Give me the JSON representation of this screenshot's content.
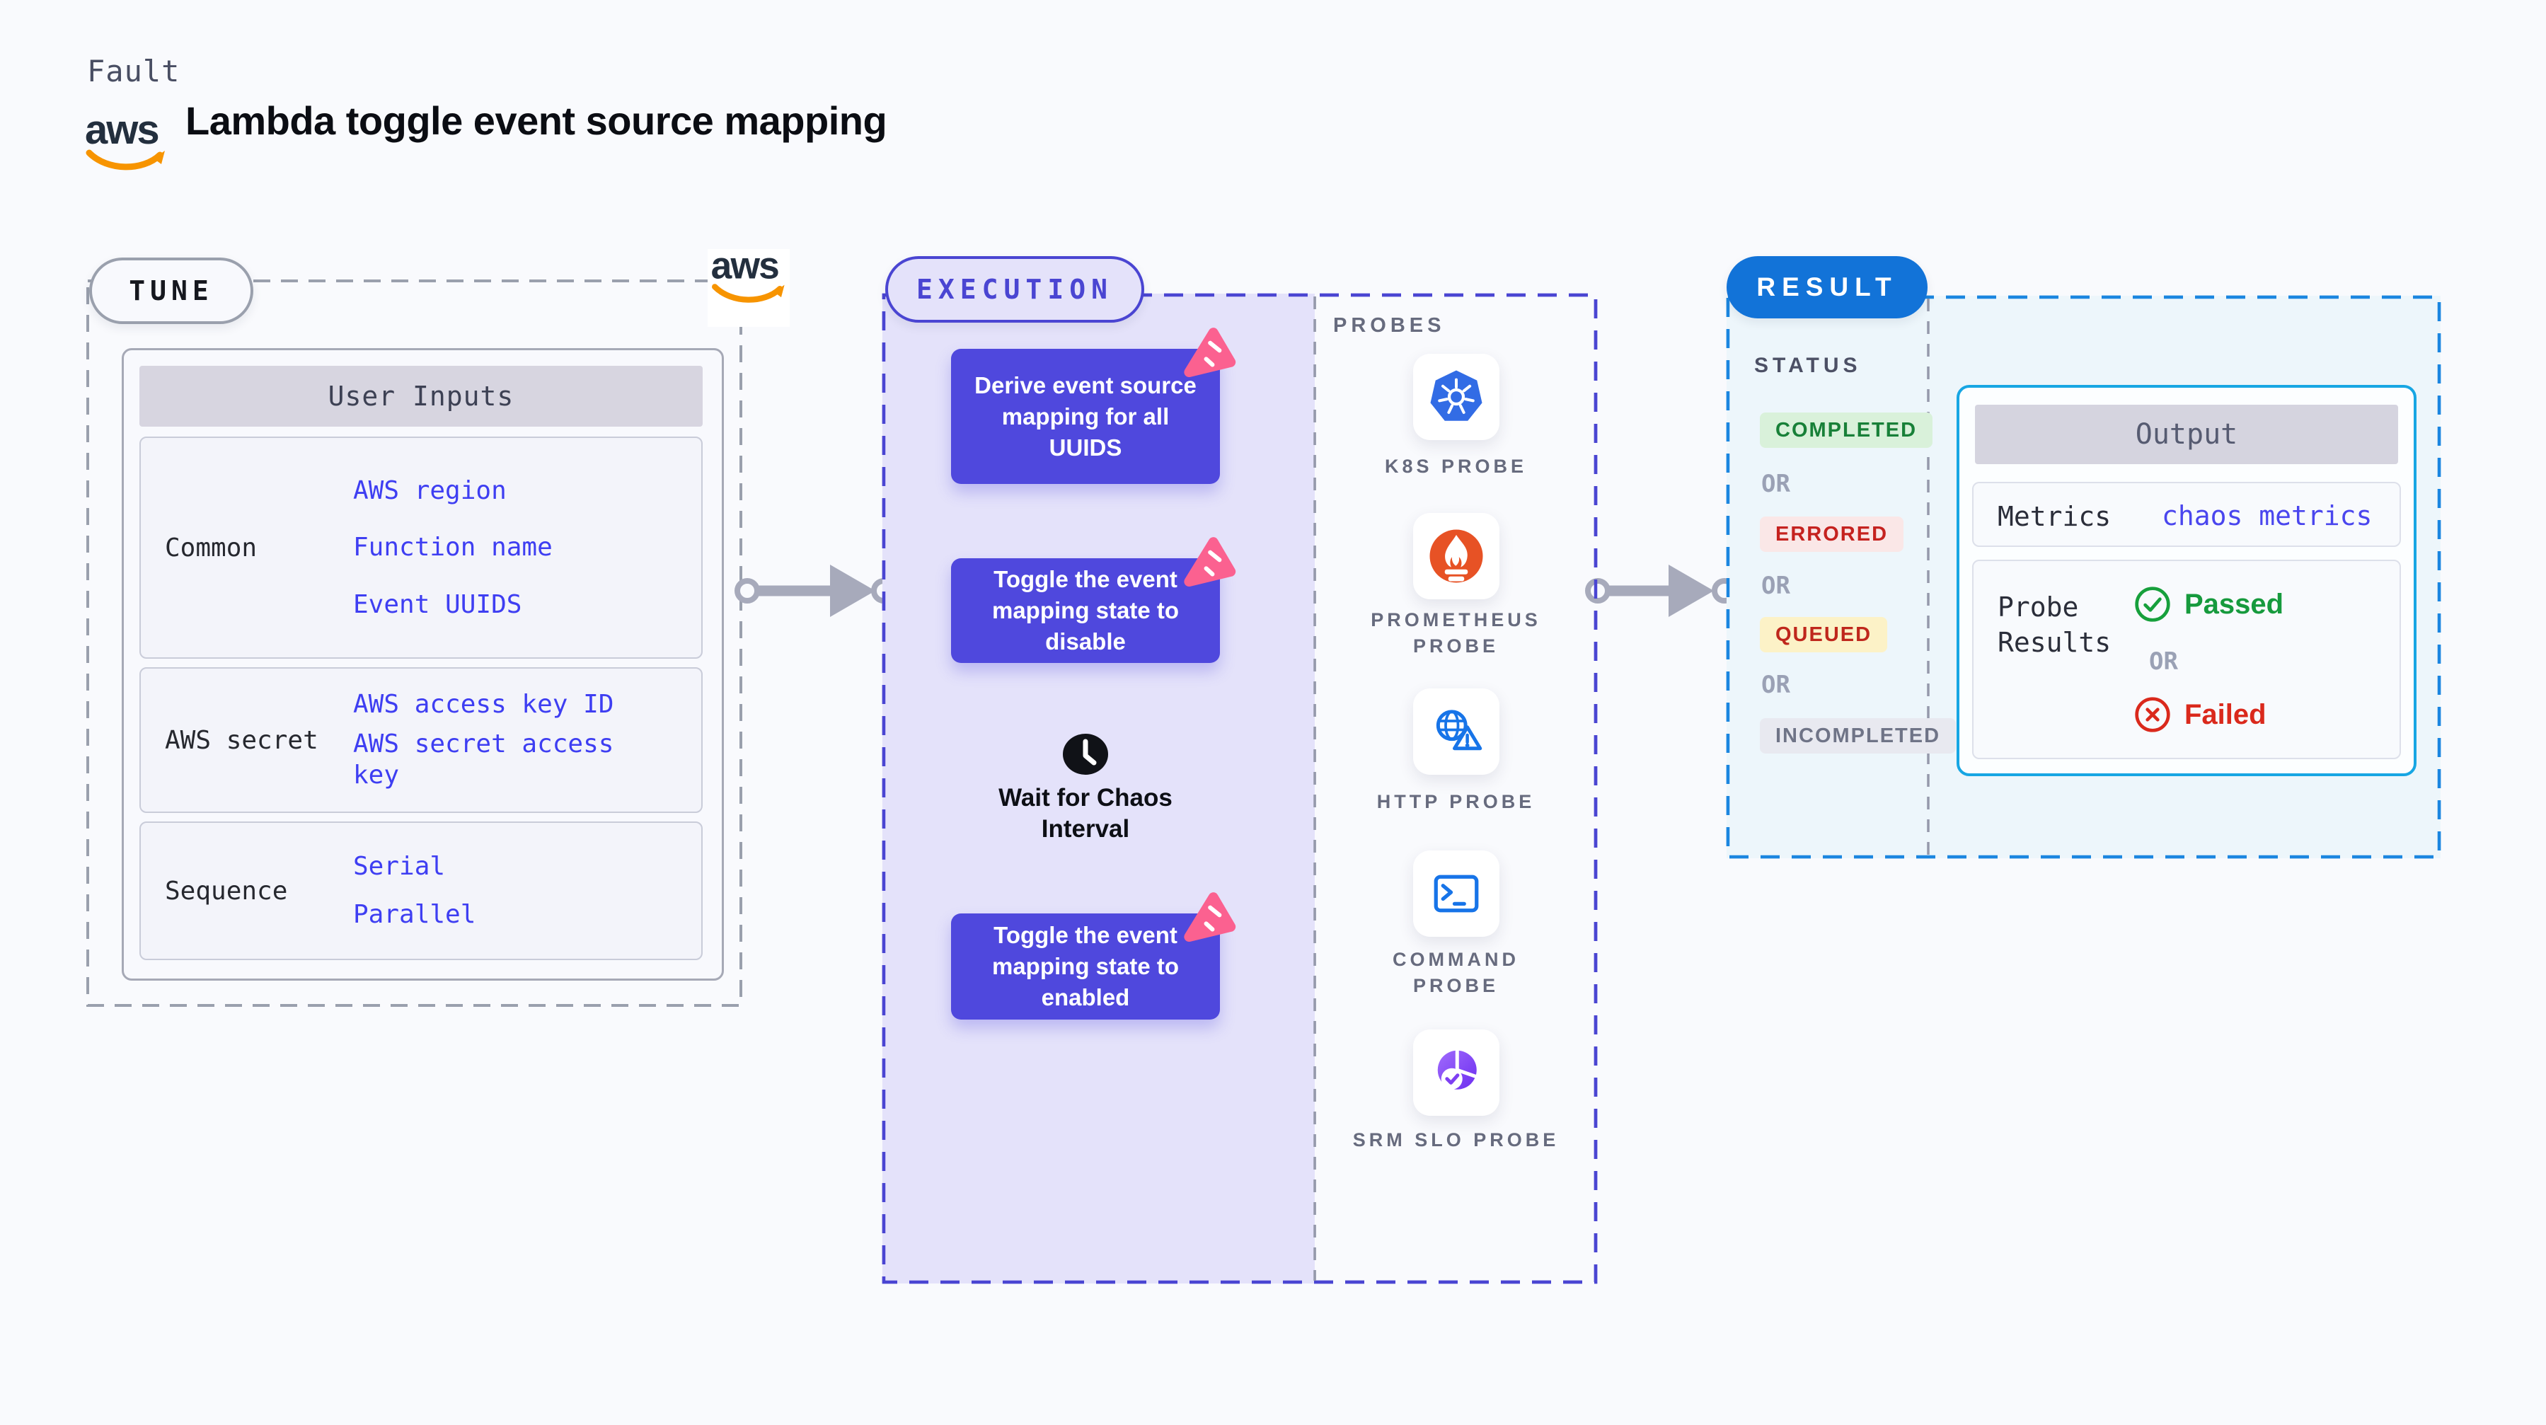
{
  "header": {
    "eyebrow": "Fault",
    "title": "Lambda toggle event source mapping",
    "aws_wordmark": "aws"
  },
  "tune": {
    "badge": "TUNE",
    "user_inputs": {
      "header": "User Inputs",
      "rows": [
        {
          "label": "Common",
          "values": [
            "AWS region",
            "Function name",
            "Event UUIDS"
          ]
        },
        {
          "label": "AWS secret",
          "values": [
            "AWS access key ID",
            "AWS secret access key"
          ]
        },
        {
          "label": "Sequence",
          "values": [
            "Serial",
            "Parallel"
          ]
        }
      ]
    }
  },
  "execution": {
    "badge": "EXECUTION",
    "steps": [
      "Derive event source mapping for all UUIDS",
      "Toggle the event mapping state to disable",
      "Toggle the event mapping state to enabled"
    ],
    "wait_step": "Wait for Chaos Interval"
  },
  "probes": {
    "title": "PROBES",
    "items": [
      {
        "icon": "kubernetes-icon",
        "label": "K8S PROBE"
      },
      {
        "icon": "prometheus-icon",
        "label": "PROMETHEUS PROBE"
      },
      {
        "icon": "http-globe-warning-icon",
        "label": "HTTP PROBE"
      },
      {
        "icon": "terminal-icon",
        "label": "COMMAND PROBE"
      },
      {
        "icon": "slo-donut-check-icon",
        "label": "SRM SLO PROBE"
      }
    ]
  },
  "result": {
    "badge": "RESULT",
    "status_heading": "STATUS",
    "or_label": "OR",
    "statuses": [
      {
        "label": "COMPLETED",
        "color": "#188038",
        "bg": "#d9f1da"
      },
      {
        "label": "ERRORED",
        "color": "#c5221f",
        "bg": "#fae7e7"
      },
      {
        "label": "QUEUED",
        "color": "#bf271c",
        "bg": "#fcf2c7"
      },
      {
        "label": "INCOMPLETED",
        "color": "#6f7487",
        "bg": "#e8e9f0"
      }
    ],
    "output": {
      "header": "Output",
      "metrics_label": "Metrics",
      "metrics_value": "chaos metrics",
      "probe_results_label": "Probe Results",
      "passed_label": "Passed",
      "failed_label": "Failed"
    }
  },
  "colors": {
    "page_bg": "#f9fafd",
    "indigo_accent": "#4a45d2",
    "node_fill": "#4f48dd",
    "lavender_fill": "#e4e2fa",
    "result_blue": "#1273d8",
    "result_dash": "#1b86e0",
    "output_border": "#17a6e3",
    "value_blue": "#3e3ef2",
    "passed_green": "#169a3d",
    "failed_red": "#da291c",
    "aws_orange": "#f79400",
    "litmus_pink": "#fb6190",
    "gray_dash": "#9aa0ad"
  }
}
